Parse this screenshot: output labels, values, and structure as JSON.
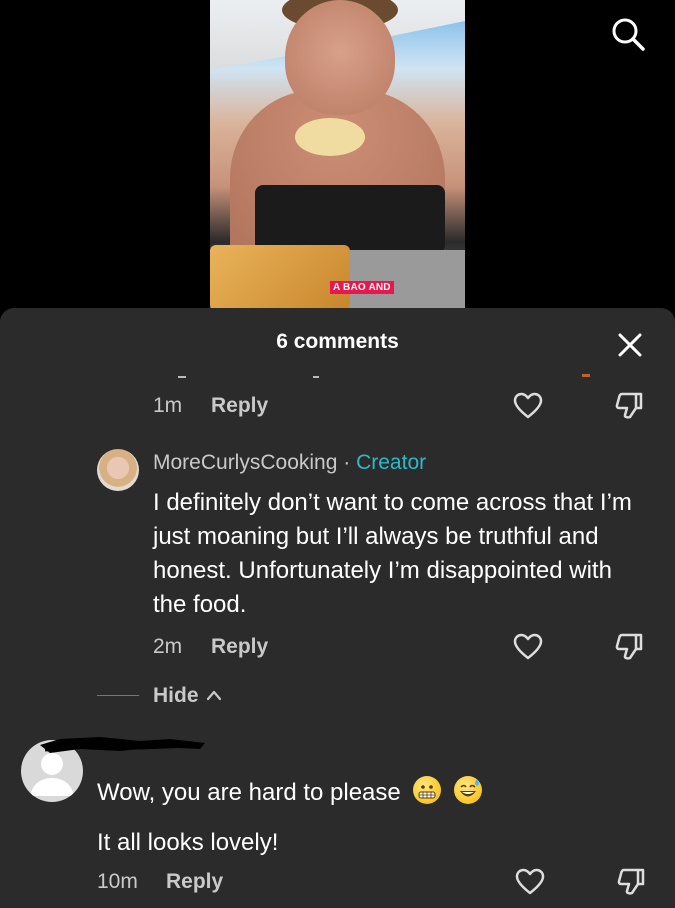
{
  "video": {
    "caption": "A BAO AND"
  },
  "sheet": {
    "title": "6 comments"
  },
  "comments": [
    {
      "time": "1m",
      "reply_label": "Reply"
    },
    {
      "username": "MoreCurlysCooking",
      "separator": "·",
      "badge": "Creator",
      "text": "I definitely don’t want to come across that I’m just moaning but I’ll always be truthful and honest. Unfortunately I’m disappointed with the food.",
      "time": "2m",
      "reply_label": "Reply"
    },
    {
      "text_line1": "Wow, you are hard to please",
      "text_line2": "It all looks lovely!",
      "emojis": [
        "grimacing-face-emoji",
        "grinning-sweat-emoji"
      ],
      "time": "10m",
      "reply_label": "Reply"
    }
  ],
  "thread": {
    "hide_label": "Hide"
  },
  "colors": {
    "sheet_bg": "#2b2b2b",
    "creator_badge": "#2cb9c8",
    "caption_bg": "#e8174e"
  },
  "icons": [
    "search-icon",
    "close-icon",
    "heart-icon",
    "dislike-icon",
    "chevron-up-icon"
  ]
}
